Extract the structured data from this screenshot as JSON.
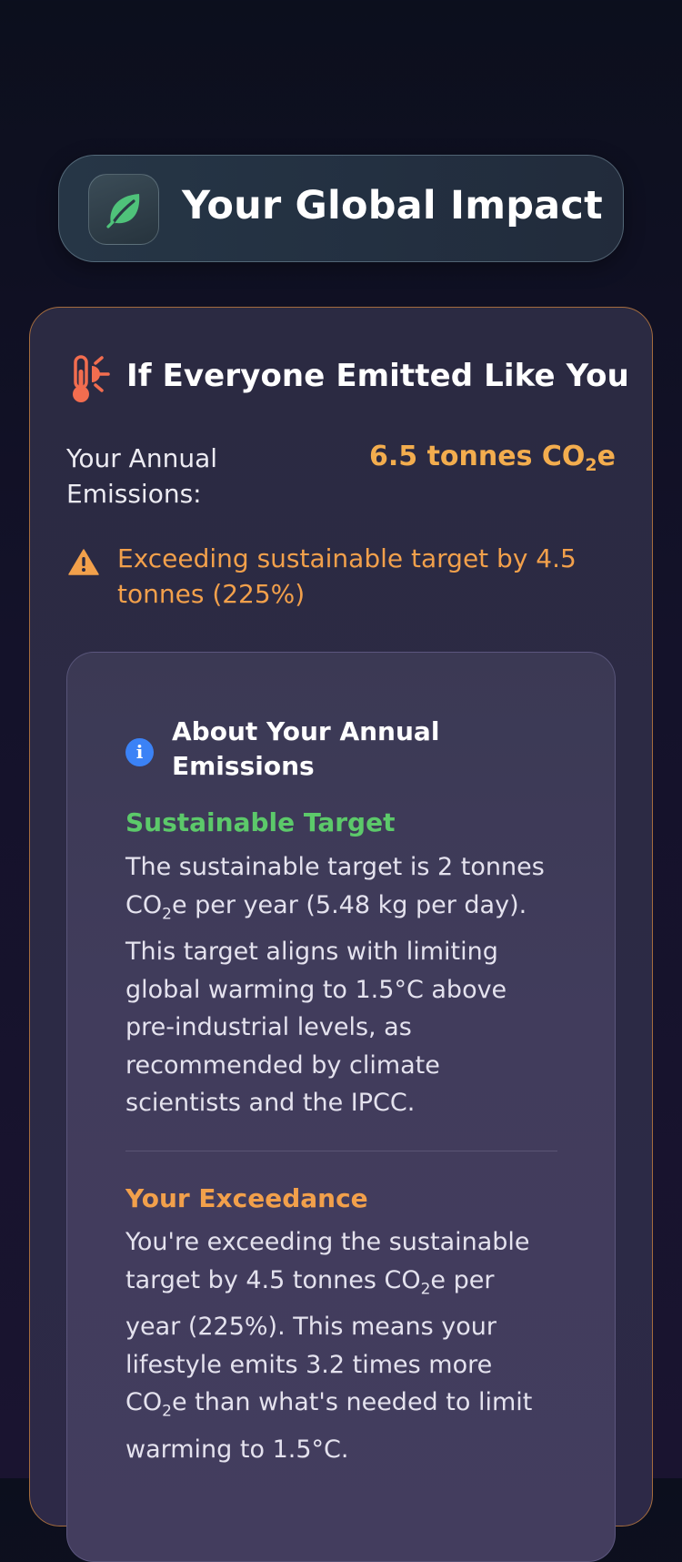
{
  "header": {
    "title": "Your Global Impact",
    "icon": "leaf-icon",
    "icon_color": "#4fc27a"
  },
  "impact_card": {
    "title": "If Everyone Emitted Like You",
    "title_icon": "thermometer-sun-icon",
    "annual_label": "Your Annual Emissions:",
    "annual_value": "6.5 tonnes CO",
    "annual_value_sub": "2",
    "annual_value_suffix": "e",
    "warning_icon": "warning-triangle-icon",
    "warning_text": "Exceeding sustainable target by 4.5 tonnes (225%)",
    "accent_color": "#f3ad4e",
    "warning_color": "#f2a04b"
  },
  "info_panel": {
    "icon": "info-icon",
    "title": "About Your Annual Emissions",
    "sustainable": {
      "heading": "Sustainable Target",
      "heading_color": "#5cc96a",
      "text_1": "The sustainable target is 2 tonnes CO",
      "text_1_sub": "2",
      "text_2": "e per year (5.48 kg per day). This target aligns with limiting global warming to 1.5°C above pre-industrial levels, as recommended by climate scientists and the IPCC."
    },
    "exceedance": {
      "heading": "Your Exceedance",
      "heading_color": "#f2a04b",
      "text_1": "You're exceeding the sustainable target by 4.5 tonnes CO",
      "text_1_sub": "2",
      "text_2": "e per year (225%). This means your lifestyle emits 3.2 times more CO",
      "text_2_sub": "2",
      "text_3": "e than what's needed to limit warming to 1.5°C."
    }
  }
}
